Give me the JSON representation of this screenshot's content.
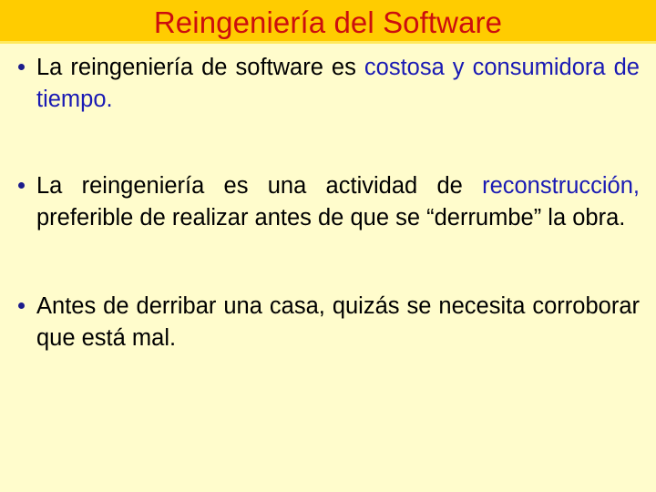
{
  "slide": {
    "title": "Reingeniería del Software",
    "colors": {
      "title_band_bg": "#FFCC00",
      "title_text": "#CC0E0E",
      "body_bg": "#FFFCCC",
      "body_text": "#000000",
      "accent_text": "#1A1AB4",
      "bullet_dot": "#1C1C8C"
    },
    "bullets": [
      {
        "marker": "bullet-dot",
        "segments": [
          {
            "text": "La reingeniería de software es ",
            "color": "black"
          },
          {
            "text": "costosa y consumidora de tiempo.",
            "color": "blue"
          }
        ],
        "plain_text": "La reingeniería de software es costosa y consumidora de tiempo."
      },
      {
        "marker": "bullet-dot",
        "segments": [
          {
            "text": "La reingeniería es una actividad de ",
            "color": "black"
          },
          {
            "text": "reconstrucción,",
            "color": "blue"
          },
          {
            "text": " preferible de realizar antes de que se “derrumbe” la obra.",
            "color": "black"
          }
        ],
        "plain_text": "La reingeniería es una actividad de reconstrucción, preferible de realizar antes de que se “derrumbe” la obra."
      },
      {
        "marker": "bullet-dot",
        "segments": [
          {
            "text": "Antes de derribar una casa, quizás se necesita corroborar que está mal.",
            "color": "black"
          }
        ],
        "plain_text": "Antes de derribar una casa, quizás se necesita corroborar que está mal."
      }
    ]
  }
}
